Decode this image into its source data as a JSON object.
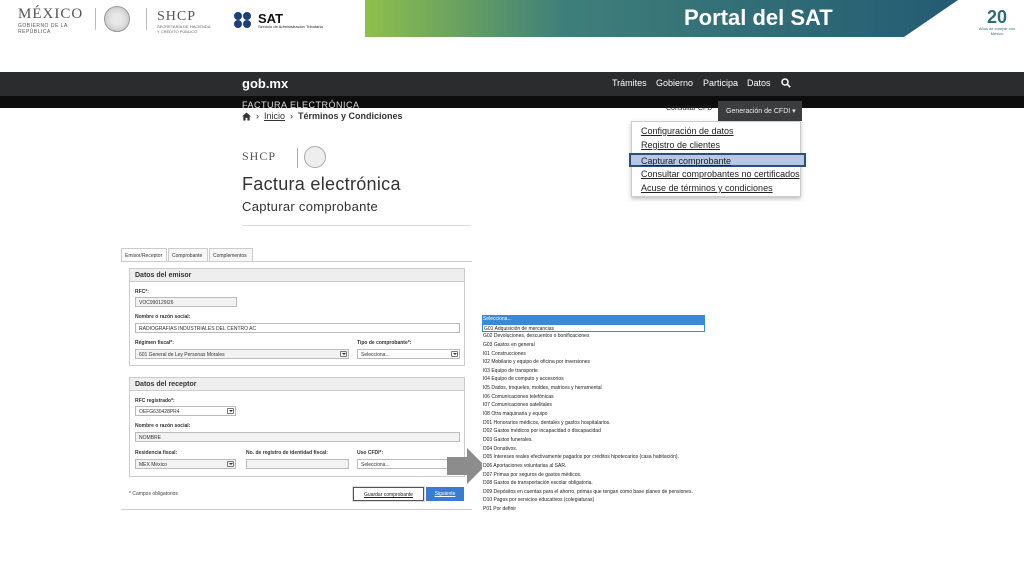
{
  "banner": {
    "mexico": "MÉXICO",
    "mexico_sub": "GOBIERNO DE LA REPÚBLICA",
    "shcp": "SHCP",
    "shcp_sub1": "SECRETARÍA DE HACIENDA",
    "shcp_sub2": "Y CRÉDITO PÚBLICO",
    "sat": "SAT",
    "sat_sub": "Servicio de Administración Tributaria",
    "portal_title": "Portal del SAT",
    "anniv_number": "20",
    "anniv_text": "Años de cumplir con México"
  },
  "navbar": {
    "brand": "gob.mx",
    "links": [
      "Trámites",
      "Gobierno",
      "Participa",
      "Datos"
    ],
    "section": "FACTURA ELECTRÓNICA",
    "consultar_cfd": "Consultar CFD",
    "generacion": "Generación de CFDI"
  },
  "menu": {
    "items": [
      "Configuración de datos",
      "Registro de clientes",
      "Capturar comprobante",
      "Consultar comprobantes no certificados",
      "Acuse de términos y condiciones"
    ],
    "selected_index": 2
  },
  "breadcrumb": {
    "home": "Inicio",
    "current": "Términos y Condiciones"
  },
  "page": {
    "logo": "SHCP",
    "title": "Factura electrónica",
    "subtitle": "Capturar comprobante"
  },
  "form": {
    "tabs": [
      "Emisor/Receptor",
      "Comprobante",
      "Complementos"
    ],
    "emisor": {
      "heading": "Datos del emisor",
      "rfc_label": "RFC*:",
      "rfc_value": "VOC990129I26",
      "nombre_label": "Nombre o razón social:",
      "nombre_value": "RADIOGRAFIAS INDUSTRIALES DEL CENTRO AC",
      "regimen_label": "Régimen fiscal*:",
      "regimen_value": "601 General de Ley Personas Morales",
      "tipo_label": "Tipo de comprobante*:",
      "tipo_value": "Selecciona..."
    },
    "receptor": {
      "heading": "Datos del receptor",
      "rfc_label": "RFC registrado*:",
      "rfc_value": "OEFG630428PR4",
      "nombre_label": "Nombre o razón social:",
      "nombre_value": "NOMBRE",
      "residencia_label": "Residencia fiscal:",
      "residencia_value": "MEX México",
      "registro_label": "No. de registro de identidad fiscal:",
      "uso_label": "Uso CFDI*:",
      "uso_value": "Selecciona..."
    },
    "required_note": "* Campos obligatorios",
    "save_label": "Guardar comprobante",
    "next_label": "Siguiente"
  },
  "uso_cfdi_options": [
    "Selecciona...",
    "G01 Adquisición de mercancias",
    "G02 Devoluciones, descuentos o bonificaciones",
    "G03 Gastos en general",
    "I01 Construcciones",
    "I02 Mobilario y equipo de oficina por inversiones",
    "I03 Equipo de transporte",
    "I04 Equipo de computo y accesorios",
    "I05 Dados, troqueles, moldes, matrices y herramental",
    "I06 Comunicaciones telefónicas",
    "I07 Comunicaciones satelitales",
    "I08 Otra maquinaria y equipo",
    "D01 Honorarios médicos, dentales y gastos hospitalarios.",
    "D02 Gastos médicos por incapacidad o discapacidad",
    "D03 Gastos funerales.",
    "D04 Donativos.",
    "D05 Intereses reales efectivamente pagados por créditos hipotecarios (casa habitación).",
    "D06 Aportaciones voluntarias al SAR.",
    "D07 Primas por seguros de gastos médicos.",
    "D08 Gastos de transportación escolar obligatoria.",
    "D09 Depósitos en cuentas para el ahorro, primas que tengan como base planes de pensiones.",
    "D10 Pagos por servicios educativos (colegiaturas)",
    "P01 Por definir"
  ],
  "colors": {
    "navbar": "#2b2c2e",
    "highlight": "#3a89d6",
    "menu_selected": "#b8c7e3",
    "next_button": "#3a7bd5"
  }
}
